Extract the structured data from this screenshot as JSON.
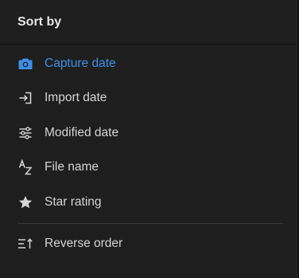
{
  "menu": {
    "title": "Sort by",
    "accent_color": "#3f8fe8",
    "items": [
      {
        "label": "Capture date",
        "icon": "camera-icon",
        "selected": true
      },
      {
        "label": "Import date",
        "icon": "import-icon",
        "selected": false
      },
      {
        "label": "Modified date",
        "icon": "sliders-icon",
        "selected": false
      },
      {
        "label": "File name",
        "icon": "a-z-icon",
        "selected": false
      },
      {
        "label": "Star rating",
        "icon": "star-icon",
        "selected": false
      }
    ],
    "reverse": {
      "label": "Reverse order",
      "icon": "reverse-order-icon"
    }
  }
}
